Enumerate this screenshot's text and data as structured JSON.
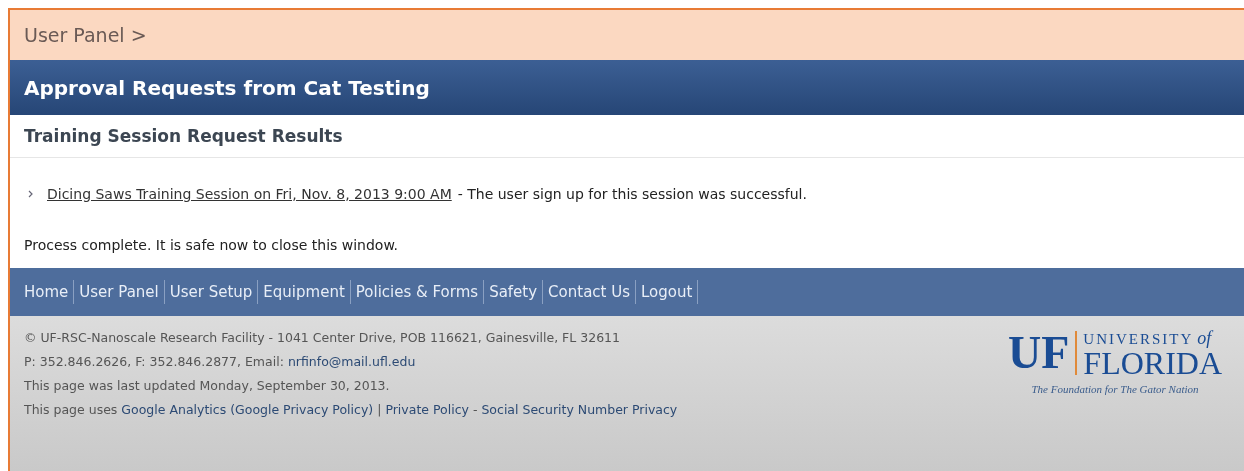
{
  "breadcrumb": "User Panel >",
  "page_title": "Approval Requests from Cat Testing",
  "section_title": "Training Session Request Results",
  "results": [
    {
      "link": "Dicing Saws Training Session on Fri, Nov. 8, 2013 9:00 AM",
      "message": "- The user sign up for this session was successful."
    }
  ],
  "status_message": "Process complete. It is safe now to close this window.",
  "nav": [
    "Home",
    "User Panel",
    "User Setup",
    "Equipment",
    "Policies & Forms",
    "Safety",
    "Contact Us",
    "Logout"
  ],
  "footer_lines": [
    [
      {
        "kind": "text",
        "text": "© UF-RSC-Nanoscale Research Facility - 1041 Center Drive, POB 116621, Gainesville, FL 32611"
      }
    ],
    [
      {
        "kind": "text",
        "text": "P: 352.846.2626, F: 352.846.2877, Email:"
      },
      {
        "kind": "link",
        "text": "nrfinfo@mail.ufl.edu"
      }
    ],
    [
      {
        "kind": "text",
        "text": "This page was last updated Monday, September 30, 2013."
      }
    ],
    [
      {
        "kind": "text",
        "text": "This page uses"
      },
      {
        "kind": "link",
        "text": "Google Analytics"
      },
      {
        "kind": "link",
        "text": "(Google Privacy Policy)"
      },
      {
        "kind": "text",
        "text": "|"
      },
      {
        "kind": "link",
        "text": "Private Policy"
      },
      {
        "kind": "text",
        "text": "-"
      },
      {
        "kind": "link",
        "text": "Social Security Number Privacy"
      }
    ]
  ],
  "logo": {
    "mark": "UF",
    "top": "UNIVERSITY",
    "top_small": "of",
    "name": "FLORIDA",
    "tagline": "The Foundation for The Gator Nation"
  }
}
